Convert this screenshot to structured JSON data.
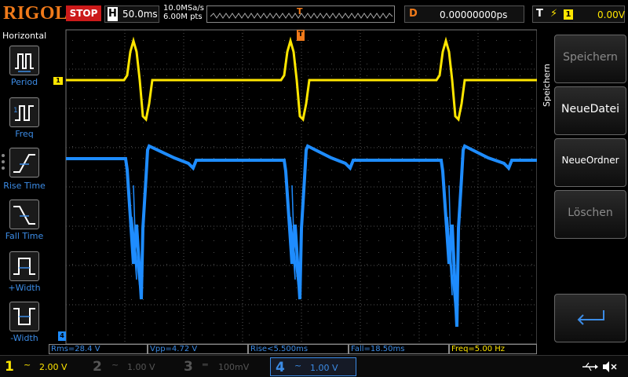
{
  "top": {
    "logo": "RIGOL",
    "run_state": "STOP",
    "timebase_label": "H",
    "timebase_value": "50.0ms",
    "sample_rate": "10.0MSa/s",
    "memory_depth": "6.00M pts",
    "trigger_pos_marker": "T",
    "delay_label": "D",
    "delay_value": "0.00000000ps",
    "trigger_label": "T",
    "trigger_edge": "⚡",
    "trigger_source": "1",
    "trigger_level": "0.00V"
  },
  "left_panel": {
    "title": "Horizontal",
    "items": [
      {
        "label": "Period"
      },
      {
        "label": "Freq"
      },
      {
        "label": "Rise Time"
      },
      {
        "label": "Fall Time"
      },
      {
        "label": "+Width"
      },
      {
        "label": "-Width"
      }
    ]
  },
  "right_panel": {
    "vertical_title": "Speichern",
    "buttons": [
      {
        "label": "Speichern",
        "enabled": false
      },
      {
        "label": "NeueDatei",
        "enabled": true
      },
      {
        "label": "NeueOrdner",
        "enabled": true
      },
      {
        "label": "Löschen",
        "enabled": false
      }
    ],
    "enter_icon": "return-arrow-icon"
  },
  "markers": {
    "ch1": "1",
    "trigger_top": "T",
    "ch4_bottom": "4"
  },
  "measurements": [
    {
      "text": "Rms=28.4 V",
      "color": "#3c8ce6"
    },
    {
      "text": "Vpp=4.72 V",
      "color": "#3c8ce6"
    },
    {
      "text": "Rise<5.500ms",
      "color": "#3c8ce6"
    },
    {
      "text": "Fall=18.50ms",
      "color": "#3c8ce6"
    },
    {
      "text": "Freq=5.00 Hz",
      "color": "#ffe600"
    }
  ],
  "channels": [
    {
      "num": "1",
      "coupling": "~",
      "scale": "2.00 V",
      "color": "#ffe600",
      "active": true
    },
    {
      "num": "2",
      "coupling": "~",
      "scale": "1.00 V",
      "color": "#555555",
      "active": false
    },
    {
      "num": "3",
      "coupling": "═",
      "scale": "100mV",
      "color": "#555555",
      "active": false
    },
    {
      "num": "4",
      "coupling": "~",
      "scale": "1.00 V",
      "color": "#3c8ce6",
      "active": true
    }
  ],
  "status_icons": [
    "usb-icon",
    "speaker-muted-icon"
  ],
  "colors": {
    "ch1": "#ffe600",
    "ch4": "#1e8cff",
    "accent": "#f07a1a",
    "stop": "#cc1a1a"
  }
}
